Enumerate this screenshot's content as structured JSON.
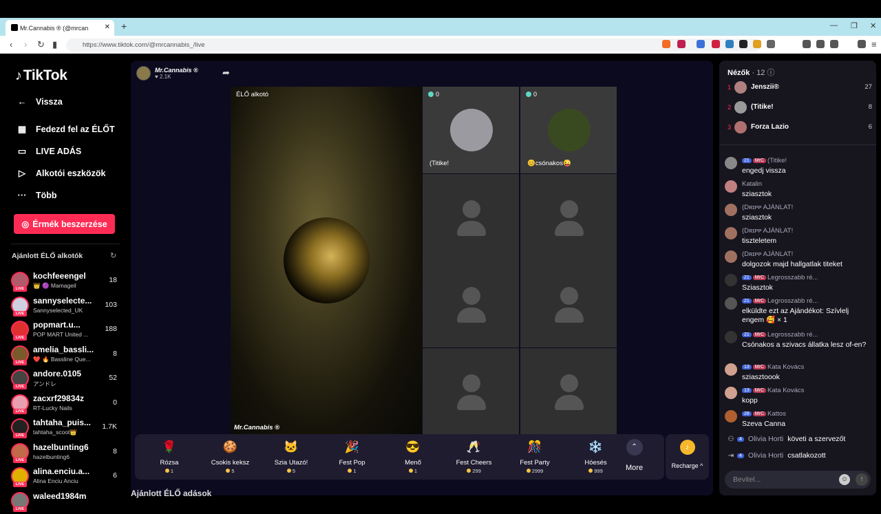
{
  "browser": {
    "tab_title": "Mr.Cannabis ® (@mrcan",
    "url": "https://www.tiktok.com/@mrcannabis_/live"
  },
  "sidebar": {
    "logo": "TikTok",
    "back": "Vissza",
    "nav": [
      {
        "label": "Fedezd fel az ÉLŐT",
        "icon": "calendar-icon"
      },
      {
        "label": "LIVE ADÁS",
        "icon": "camera-icon"
      },
      {
        "label": "Alkotói eszközök",
        "icon": "tools-icon"
      },
      {
        "label": "Több",
        "icon": "more-icon"
      }
    ],
    "coins_button": "Érmék beszerzése",
    "recommended_title": "Ajánlott ÉLŐ alkotók",
    "creators": [
      {
        "name": "kochfeeengel",
        "sub": "👑 🟣 Mamageil",
        "count": "18",
        "color": "#b05a6a"
      },
      {
        "name": "sannyselecte...",
        "sub": "Sannyselected_UK",
        "count": "103",
        "color": "#d0d0e0"
      },
      {
        "name": "popmart.u...",
        "sub": "POP MART United ...",
        "count": "188",
        "color": "#e03030"
      },
      {
        "name": "amelia_bassli...",
        "sub": "❤️ 🔥 Bassline Que...",
        "count": "8",
        "color": "#7a5a2a"
      },
      {
        "name": "andore.0105",
        "sub": "アンドレ",
        "count": "52",
        "color": "#444"
      },
      {
        "name": "zacxrf29834z",
        "sub": "RT-Lucky Nails",
        "count": "0",
        "color": "#e8a0b0"
      },
      {
        "name": "tahtaha_puis...",
        "sub": "tahtaha_scoot👑",
        "count": "1.7K",
        "color": "#222"
      },
      {
        "name": "hazelbunting6",
        "sub": "hazelbunting6",
        "count": "8",
        "color": "#c06a4a"
      },
      {
        "name": "alina.enciu.a...",
        "sub": "Alina Enciu Anciu",
        "count": "6",
        "color": "#e0b000"
      },
      {
        "name": "waleed1984m",
        "sub": "",
        "count": "",
        "color": "#777"
      }
    ]
  },
  "stream": {
    "host_name": "Mr.Cannabis ®",
    "host_likes": "2.1K",
    "main_tag": "ÉLŐ alkotó",
    "watermark": "Mr.Cannabis ®",
    "guests": [
      {
        "name": "(Titike!",
        "count": "0",
        "color": "#9a9aa0"
      },
      {
        "name": "😊csónakos😜",
        "count": "0",
        "color": "#3a4a20"
      }
    ],
    "gifts": [
      {
        "name": "Rózsa",
        "price": "1",
        "icon": "🌹"
      },
      {
        "name": "Csokis keksz",
        "price": "5",
        "icon": "🍪"
      },
      {
        "name": "Szia Utazó!",
        "price": "5",
        "icon": "🐱"
      },
      {
        "name": "Fest Pop",
        "price": "1",
        "icon": "🎉"
      },
      {
        "name": "Menő",
        "price": "1",
        "icon": "😎"
      },
      {
        "name": "Fest Cheers",
        "price": "299",
        "icon": "🥂"
      },
      {
        "name": "Fest Party",
        "price": "2999",
        "icon": "🎊"
      },
      {
        "name": "Hóesés",
        "price": "999",
        "icon": "❄️"
      }
    ],
    "more": "More",
    "recharge": "Recharge ^"
  },
  "below_title": "Ajánlott ÉLŐ adások",
  "chat": {
    "viewers_title": "Nézők",
    "viewers_count": "· 12",
    "top_viewers": [
      {
        "rank": "1",
        "name": "Jenszii®",
        "count": "27",
        "color": "#b08080"
      },
      {
        "rank": "2",
        "name": "(Titike!",
        "count": "8",
        "color": "#999"
      },
      {
        "rank": "3",
        "name": "Forza Lazio",
        "count": "6",
        "color": "#b07070"
      }
    ],
    "messages": [
      {
        "user": "(Titike!",
        "badges": [
          "21",
          "MrC"
        ],
        "text": "engedj vissza",
        "color": "#888"
      },
      {
        "user": "Katalin",
        "badges": [],
        "text": "sziasztok",
        "color": "#c08080"
      },
      {
        "user": "(Dʀɪᴘᴘ AJÁNLAT!",
        "badges": [],
        "text": "sziasztok",
        "color": "#a07060"
      },
      {
        "user": "(Dʀɪᴘᴘ AJÁNLAT!",
        "badges": [],
        "text": "tiszteletem",
        "color": "#a07060"
      },
      {
        "user": "(Dʀɪᴘᴘ AJÁNLAT!",
        "badges": [],
        "text": "dolgozok majd hallgatlak titeket",
        "color": "#a07060"
      },
      {
        "user": "Legrosszabb ré...",
        "badges": [
          "21",
          "MrC"
        ],
        "text": "Sziasztok",
        "color": "#333"
      },
      {
        "user": "Legrosszabb ré...",
        "badges": [
          "21",
          "MrC"
        ],
        "text": "elküldte ezt az Ajándékot: Szívlelj engem 🥰 × 1",
        "color": "#555"
      },
      {
        "user": "Legrosszabb ré...",
        "badges": [
          "21",
          "MrC"
        ],
        "text": "Csónakos a szivacs állatka lesz of-en?",
        "color": "#333"
      },
      {
        "user": "Kata Kovács",
        "badges": [
          "13",
          "MrC"
        ],
        "text": "sziasztoook",
        "color": "#d0a090"
      },
      {
        "user": "Kata Kovács",
        "badges": [
          "13",
          "MrC"
        ],
        "text": "kopp",
        "color": "#d0a090"
      },
      {
        "user": "Kattos",
        "badges": [
          "28",
          "MrC"
        ],
        "text": "Szeva Canna",
        "color": "#b06030"
      }
    ],
    "system": [
      {
        "badge": "4",
        "user": "Olivia Horti",
        "text": "követi a szervezőt"
      },
      {
        "badge": "4",
        "user": "Olivia Horti",
        "text": "csatlakozott"
      }
    ],
    "input_placeholder": "Bevitel..."
  }
}
